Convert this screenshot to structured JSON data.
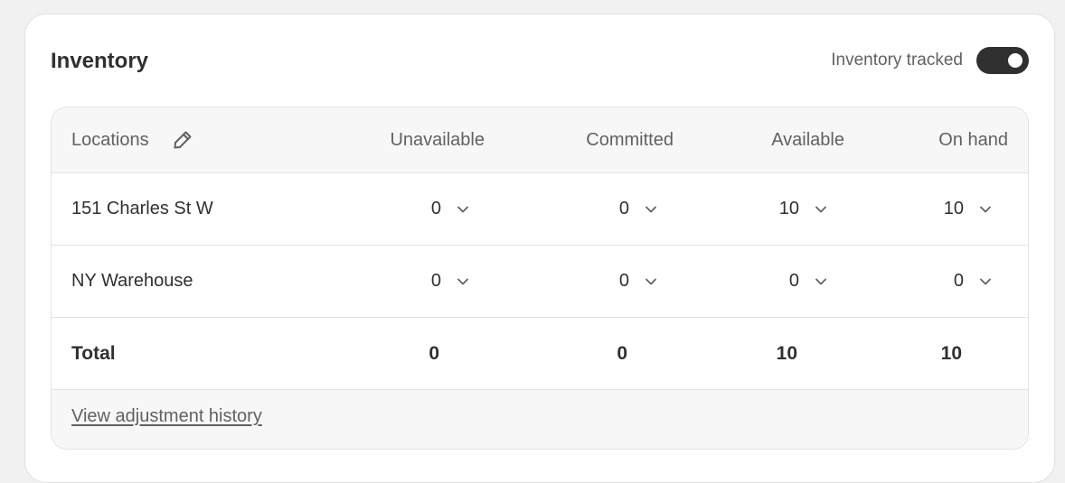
{
  "card": {
    "title": "Inventory",
    "tracked_label": "Inventory tracked",
    "tracked_on": true
  },
  "table": {
    "headers": {
      "locations": "Locations",
      "unavailable": "Unavailable",
      "committed": "Committed",
      "available": "Available",
      "on_hand": "On hand"
    },
    "rows": [
      {
        "location": "151 Charles St W",
        "unavailable": "0",
        "committed": "0",
        "available": "10",
        "on_hand": "10"
      },
      {
        "location": "NY Warehouse",
        "unavailable": "0",
        "committed": "0",
        "available": "0",
        "on_hand": "0"
      }
    ],
    "total": {
      "label": "Total",
      "unavailable": "0",
      "committed": "0",
      "available": "10",
      "on_hand": "10"
    },
    "footer_link": "View adjustment history"
  },
  "icons": {
    "edit": "pencil-icon",
    "expand": "chevron-down-icon"
  },
  "colors": {
    "text": "#303030",
    "muted": "#616161",
    "toggle_on": "#303030",
    "subdued_bg": "#f7f7f7",
    "border": "#e3e3e3"
  }
}
